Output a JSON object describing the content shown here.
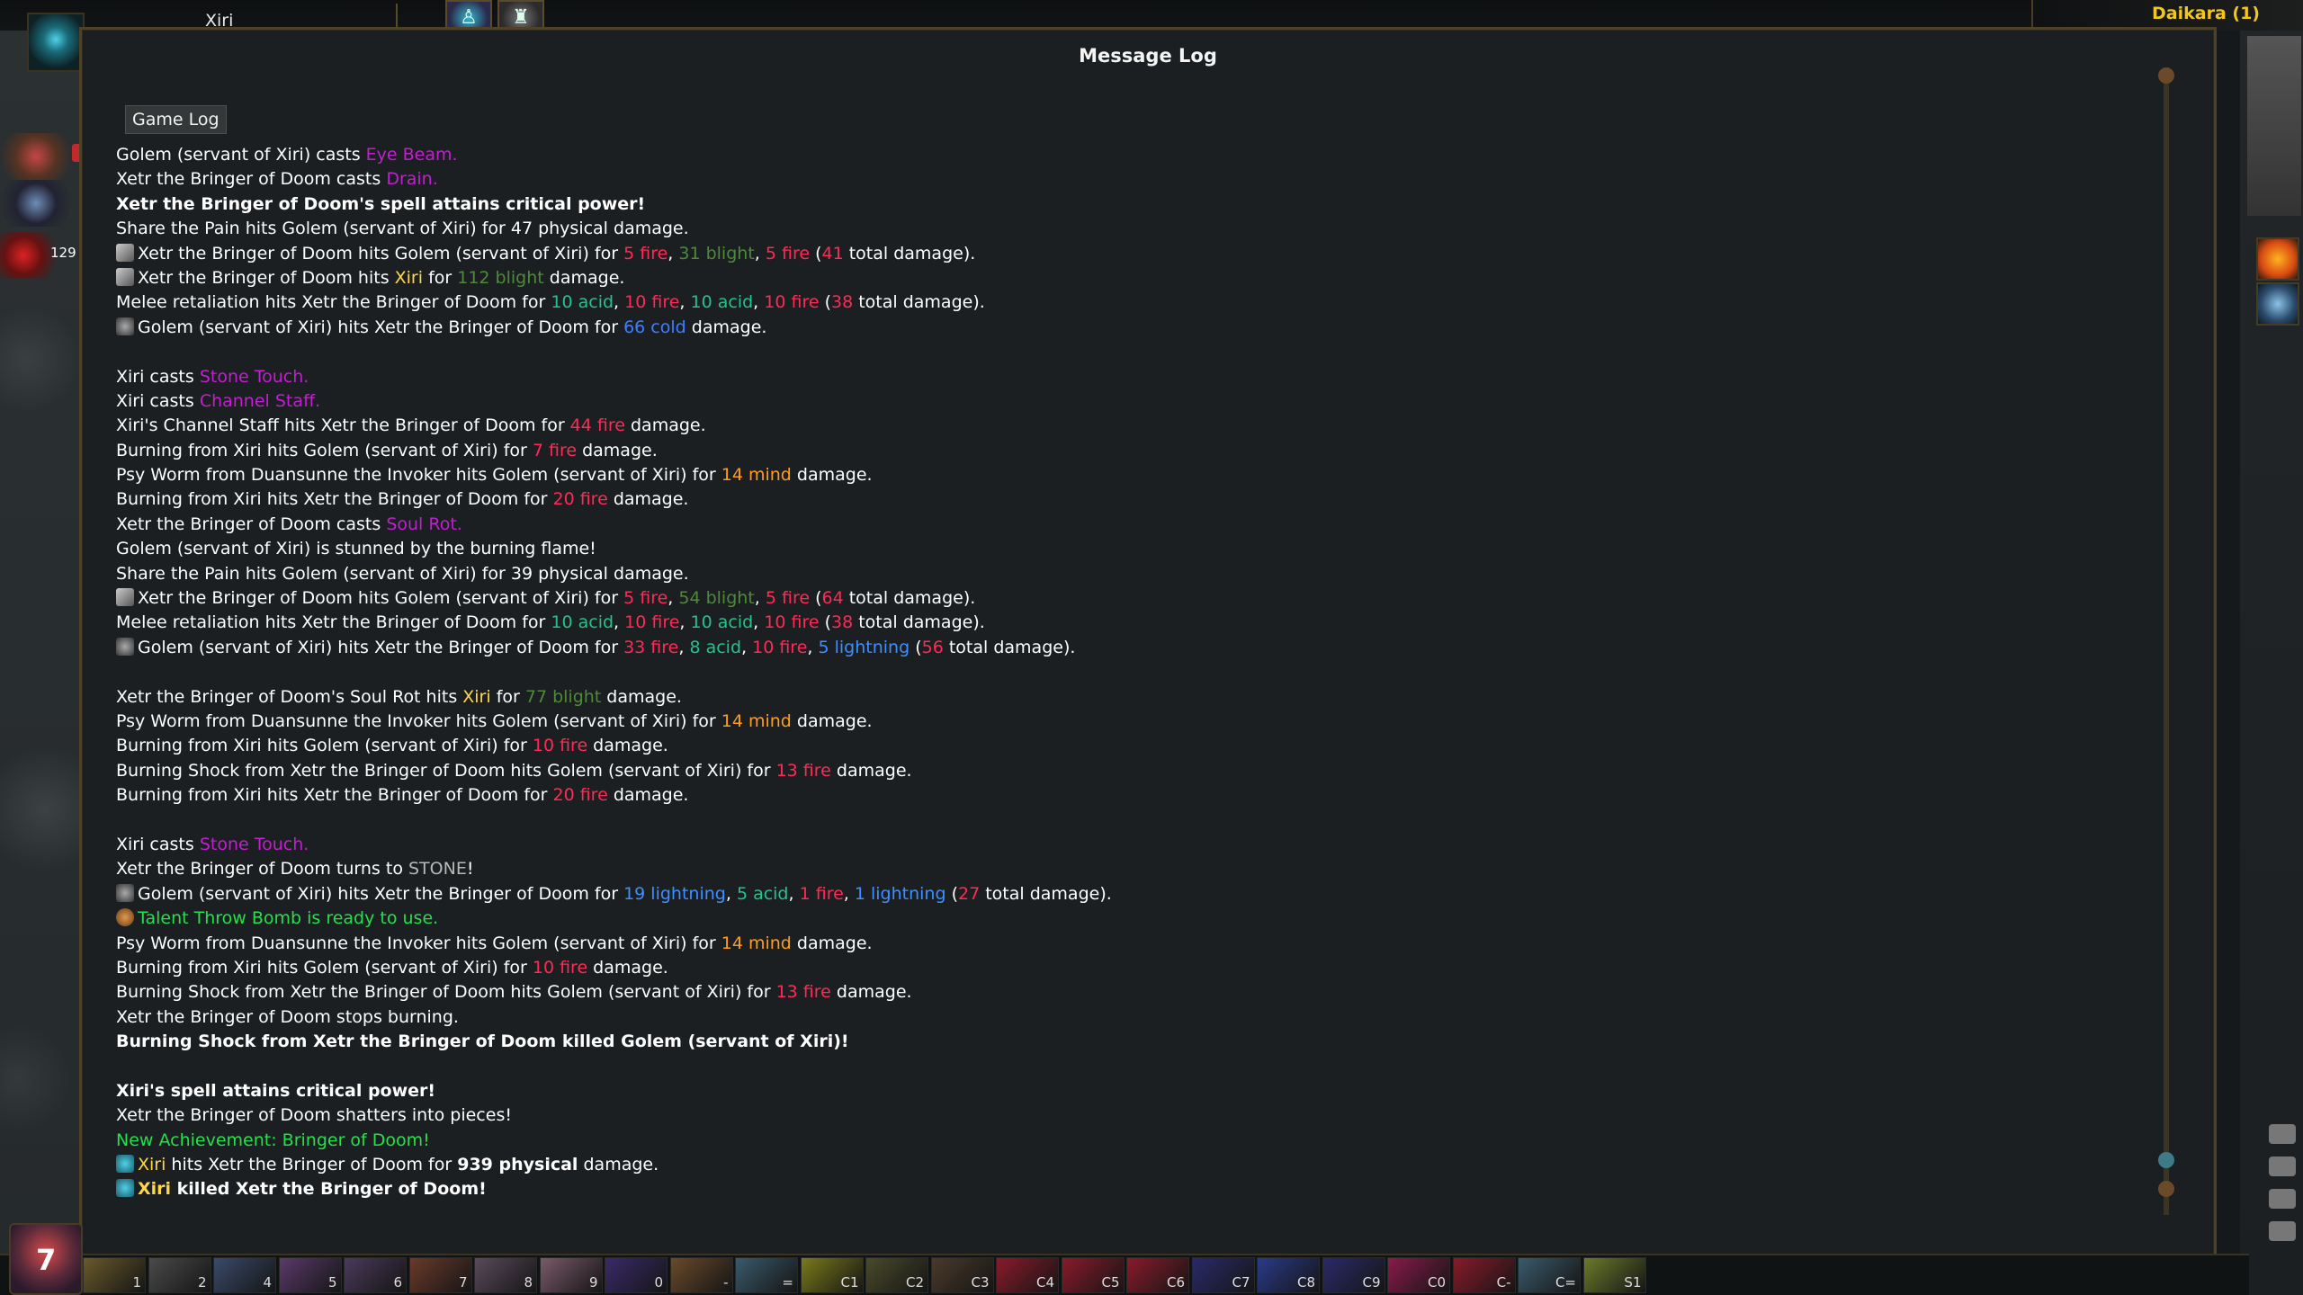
{
  "player": {
    "name": "Xiri",
    "life_value": "129"
  },
  "enemy": {
    "name": "Daikara (1)"
  },
  "window": {
    "title": "Message Log",
    "tab": "Game Log"
  },
  "colors": {
    "fire": "#ff2a55",
    "blight": "#4f8a3a",
    "acid": "#25c38a",
    "cold": "#3f7fff",
    "lightning": "#3f8fff",
    "mind": "#ff9c20",
    "spell": "#c11fcf",
    "xiri": "#ffd84a",
    "achievement": "#25e04a",
    "stone": "#b8b8b8",
    "text": "#ffffff"
  },
  "log": [
    {
      "segments": [
        {
          "t": "Golem (servant of Xiri) casts "
        },
        {
          "t": "Eye Beam.",
          "c": "spell"
        }
      ]
    },
    {
      "segments": [
        {
          "t": "Xetr the Bringer of Doom casts "
        },
        {
          "t": "Drain.",
          "c": "spell"
        }
      ]
    },
    {
      "bold": true,
      "segments": [
        {
          "t": "Xetr the Bringer of Doom's spell attains critical power!"
        }
      ]
    },
    {
      "segments": [
        {
          "t": "Share the Pain hits Golem (servant of Xiri) for 47 physical damage."
        }
      ]
    },
    {
      "icon": "sword",
      "segments": [
        {
          "t": "Xetr the Bringer of Doom hits Golem (servant of Xiri) for "
        },
        {
          "t": "5 fire",
          "c": "fire"
        },
        {
          "t": ", "
        },
        {
          "t": "31 blight",
          "c": "blight"
        },
        {
          "t": ", "
        },
        {
          "t": "5 fire",
          "c": "fire"
        },
        {
          "t": " ("
        },
        {
          "t": "41",
          "c": "fire"
        },
        {
          "t": " total damage)."
        }
      ]
    },
    {
      "icon": "sword",
      "segments": [
        {
          "t": "Xetr the Bringer of Doom hits "
        },
        {
          "t": "Xiri",
          "c": "xiri"
        },
        {
          "t": " for "
        },
        {
          "t": "112 blight",
          "c": "blight"
        },
        {
          "t": " damage."
        }
      ]
    },
    {
      "segments": [
        {
          "t": "Melee retaliation hits Xetr the Bringer of Doom for "
        },
        {
          "t": "10 acid",
          "c": "acid"
        },
        {
          "t": ", "
        },
        {
          "t": "10 fire",
          "c": "fire"
        },
        {
          "t": ", "
        },
        {
          "t": "10 acid",
          "c": "acid"
        },
        {
          "t": ", "
        },
        {
          "t": "10 fire",
          "c": "fire"
        },
        {
          "t": " ("
        },
        {
          "t": "38",
          "c": "fire"
        },
        {
          "t": " total damage)."
        }
      ]
    },
    {
      "icon": "golem",
      "segments": [
        {
          "t": "Golem (servant of Xiri) hits Xetr the Bringer of Doom for "
        },
        {
          "t": "66 cold",
          "c": "cold"
        },
        {
          "t": " damage."
        }
      ]
    },
    {
      "blank": true
    },
    {
      "segments": [
        {
          "t": "Xiri casts "
        },
        {
          "t": "Stone Touch.",
          "c": "spell"
        }
      ]
    },
    {
      "segments": [
        {
          "t": "Xiri casts "
        },
        {
          "t": "Channel Staff.",
          "c": "spell"
        }
      ]
    },
    {
      "segments": [
        {
          "t": "Xiri's Channel Staff hits Xetr the Bringer of Doom for "
        },
        {
          "t": "44 fire",
          "c": "fire"
        },
        {
          "t": " damage."
        }
      ]
    },
    {
      "segments": [
        {
          "t": "Burning from Xiri hits Golem (servant of Xiri) for "
        },
        {
          "t": "7 fire",
          "c": "fire"
        },
        {
          "t": " damage."
        }
      ]
    },
    {
      "segments": [
        {
          "t": "Psy Worm from Duansunne the Invoker hits Golem (servant of Xiri) for "
        },
        {
          "t": "14 mind",
          "c": "mind"
        },
        {
          "t": " damage."
        }
      ]
    },
    {
      "segments": [
        {
          "t": "Burning from Xiri hits Xetr the Bringer of Doom for "
        },
        {
          "t": "20 fire",
          "c": "fire"
        },
        {
          "t": " damage."
        }
      ]
    },
    {
      "segments": [
        {
          "t": "Xetr the Bringer of Doom casts "
        },
        {
          "t": "Soul Rot.",
          "c": "spell"
        }
      ]
    },
    {
      "segments": [
        {
          "t": "Golem (servant of Xiri) is stunned by the burning flame!"
        }
      ]
    },
    {
      "segments": [
        {
          "t": "Share the Pain hits Golem (servant of Xiri) for 39 physical damage."
        }
      ]
    },
    {
      "icon": "sword",
      "segments": [
        {
          "t": "Xetr the Bringer of Doom hits Golem (servant of Xiri) for "
        },
        {
          "t": "5 fire",
          "c": "fire"
        },
        {
          "t": ", "
        },
        {
          "t": "54 blight",
          "c": "blight"
        },
        {
          "t": ", "
        },
        {
          "t": "5 fire",
          "c": "fire"
        },
        {
          "t": " ("
        },
        {
          "t": "64",
          "c": "fire"
        },
        {
          "t": " total damage)."
        }
      ]
    },
    {
      "segments": [
        {
          "t": "Melee retaliation hits Xetr the Bringer of Doom for "
        },
        {
          "t": "10 acid",
          "c": "acid"
        },
        {
          "t": ", "
        },
        {
          "t": "10 fire",
          "c": "fire"
        },
        {
          "t": ", "
        },
        {
          "t": "10 acid",
          "c": "acid"
        },
        {
          "t": ", "
        },
        {
          "t": "10 fire",
          "c": "fire"
        },
        {
          "t": " ("
        },
        {
          "t": "38",
          "c": "fire"
        },
        {
          "t": " total damage)."
        }
      ]
    },
    {
      "icon": "golem",
      "segments": [
        {
          "t": "Golem (servant of Xiri) hits Xetr the Bringer of Doom for "
        },
        {
          "t": "33 fire",
          "c": "fire"
        },
        {
          "t": ", "
        },
        {
          "t": "8 acid",
          "c": "acid"
        },
        {
          "t": ", "
        },
        {
          "t": "10 fire",
          "c": "fire"
        },
        {
          "t": ", "
        },
        {
          "t": "5 lightning",
          "c": "lightning"
        },
        {
          "t": " ("
        },
        {
          "t": "56",
          "c": "fire"
        },
        {
          "t": " total damage)."
        }
      ]
    },
    {
      "blank": true
    },
    {
      "segments": [
        {
          "t": "Xetr the Bringer of Doom's Soul Rot hits "
        },
        {
          "t": "Xiri",
          "c": "xiri"
        },
        {
          "t": " for "
        },
        {
          "t": "77 blight",
          "c": "blight"
        },
        {
          "t": " damage."
        }
      ]
    },
    {
      "segments": [
        {
          "t": "Psy Worm from Duansunne the Invoker hits Golem (servant of Xiri) for "
        },
        {
          "t": "14 mind",
          "c": "mind"
        },
        {
          "t": " damage."
        }
      ]
    },
    {
      "segments": [
        {
          "t": "Burning from Xiri hits Golem (servant of Xiri) for "
        },
        {
          "t": "10 fire",
          "c": "fire"
        },
        {
          "t": " damage."
        }
      ]
    },
    {
      "segments": [
        {
          "t": "Burning Shock from Xetr the Bringer of Doom hits Golem (servant of Xiri) for "
        },
        {
          "t": "13 fire",
          "c": "fire"
        },
        {
          "t": " damage."
        }
      ]
    },
    {
      "segments": [
        {
          "t": "Burning from Xiri hits Xetr the Bringer of Doom for "
        },
        {
          "t": "20 fire",
          "c": "fire"
        },
        {
          "t": " damage."
        }
      ]
    },
    {
      "blank": true
    },
    {
      "segments": [
        {
          "t": "Xiri casts "
        },
        {
          "t": "Stone Touch.",
          "c": "spell"
        }
      ]
    },
    {
      "segments": [
        {
          "t": "Xetr the Bringer of Doom turns to "
        },
        {
          "t": "STONE",
          "c": "stone"
        },
        {
          "t": "!"
        }
      ]
    },
    {
      "icon": "golem",
      "segments": [
        {
          "t": "Golem (servant of Xiri) hits Xetr the Bringer of Doom for "
        },
        {
          "t": "19 lightning",
          "c": "lightning"
        },
        {
          "t": ", "
        },
        {
          "t": "5 acid",
          "c": "acid"
        },
        {
          "t": ", "
        },
        {
          "t": "1 fire",
          "c": "fire"
        },
        {
          "t": ", "
        },
        {
          "t": "1 lightning",
          "c": "lightning"
        },
        {
          "t": " ("
        },
        {
          "t": "27",
          "c": "fire"
        },
        {
          "t": " total damage)."
        }
      ]
    },
    {
      "icon": "bomb",
      "segments": [
        {
          "t": "Talent Throw Bomb is ready to use.",
          "c": "achievement"
        }
      ]
    },
    {
      "segments": [
        {
          "t": "Psy Worm from Duansunne the Invoker hits Golem (servant of Xiri) for "
        },
        {
          "t": "14 mind",
          "c": "mind"
        },
        {
          "t": " damage."
        }
      ]
    },
    {
      "segments": [
        {
          "t": "Burning from Xiri hits Golem (servant of Xiri) for "
        },
        {
          "t": "10 fire",
          "c": "fire"
        },
        {
          "t": " damage."
        }
      ]
    },
    {
      "segments": [
        {
          "t": "Burning Shock from Xetr the Bringer of Doom hits Golem (servant of Xiri) for "
        },
        {
          "t": "13 fire",
          "c": "fire"
        },
        {
          "t": " damage."
        }
      ]
    },
    {
      "segments": [
        {
          "t": "Xetr the Bringer of Doom stops burning."
        }
      ]
    },
    {
      "bold": true,
      "segments": [
        {
          "t": "Burning Shock from Xetr the Bringer of Doom killed Golem (servant of Xiri)!"
        }
      ]
    },
    {
      "blank": true
    },
    {
      "bold": true,
      "segments": [
        {
          "t": "Xiri's spell attains critical power!"
        }
      ]
    },
    {
      "segments": [
        {
          "t": "Xetr the Bringer of Doom shatters into pieces!"
        }
      ]
    },
    {
      "segments": [
        {
          "t": "New Achievement: Bringer of Doom!",
          "c": "achievement"
        }
      ]
    },
    {
      "icon": "xiri",
      "segments": [
        {
          "t": "Xiri",
          "c": "xiri"
        },
        {
          "t": " hits Xetr the Bringer of Doom for "
        },
        {
          "t": "939 physical",
          "bold": true
        },
        {
          "t": " damage."
        }
      ]
    },
    {
      "icon": "xiri",
      "bold": true,
      "segments": [
        {
          "t": "Xiri",
          "c": "xiri"
        },
        {
          "t": " killed Xetr the Bringer of Doom!"
        }
      ]
    }
  ],
  "hotbar": {
    "level": "7",
    "slots": [
      {
        "label": "1",
        "color": "#6a5a2a"
      },
      {
        "label": "2",
        "color": "#4a4a4a"
      },
      {
        "label": "4",
        "color": "#3a4a6a"
      },
      {
        "label": "5",
        "color": "#5a3a6a"
      },
      {
        "label": "6",
        "color": "#4a3a5a"
      },
      {
        "label": "7",
        "color": "#6a3a2a"
      },
      {
        "label": "8",
        "color": "#5a4a5a"
      },
      {
        "label": "9",
        "color": "#7a5a6a"
      },
      {
        "label": "0",
        "color": "#3a2a6a"
      },
      {
        "label": "-",
        "color": "#6a4a2a"
      },
      {
        "label": "=",
        "color": "#3a5a6a"
      },
      {
        "label": "C1",
        "color": "#7a7a1a"
      },
      {
        "label": "C2",
        "color": "#4a4a2a"
      },
      {
        "label": "C3",
        "color": "#4a3a2a"
      },
      {
        "label": "C4",
        "color": "#8a1a2a"
      },
      {
        "label": "C5",
        "color": "#8a1a2a"
      },
      {
        "label": "C6",
        "color": "#8a1a2a"
      },
      {
        "label": "C7",
        "color": "#2a2a6a"
      },
      {
        "label": "C8",
        "color": "#2a3a8a"
      },
      {
        "label": "C9",
        "color": "#2a2a6a"
      },
      {
        "label": "C0",
        "color": "#8a1a4a"
      },
      {
        "label": "C-",
        "color": "#8a1a2a"
      },
      {
        "label": "C=",
        "color": "#3a5a6a"
      },
      {
        "label": "S1",
        "color": "#6a7a2a"
      }
    ]
  }
}
